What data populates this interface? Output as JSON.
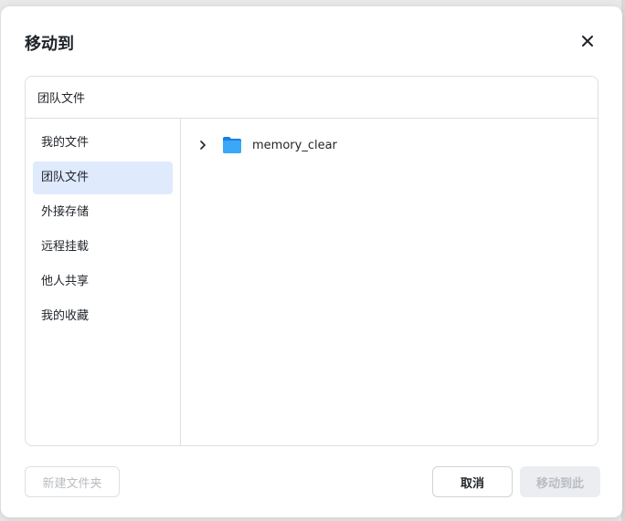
{
  "dialog": {
    "title": "移动到",
    "close_icon": "close-icon"
  },
  "panel": {
    "header": "团队文件"
  },
  "sidebar": {
    "items": [
      {
        "label": "我的文件",
        "active": false
      },
      {
        "label": "团队文件",
        "active": true
      },
      {
        "label": "外接存储",
        "active": false
      },
      {
        "label": "远程挂载",
        "active": false
      },
      {
        "label": "他人共享",
        "active": false
      },
      {
        "label": "我的收藏",
        "active": false
      }
    ]
  },
  "content": {
    "folders": [
      {
        "name": "memory_clear",
        "icon": "folder-icon",
        "expand_icon": "chevron-right-icon"
      }
    ]
  },
  "footer": {
    "new_folder_label": "新建文件夹",
    "cancel_label": "取消",
    "move_here_label": "移动到此"
  },
  "colors": {
    "active_item_bg": "#dfeafd",
    "folder_blue": "#2d9cf5",
    "disabled_text": "#b9bcc1"
  }
}
